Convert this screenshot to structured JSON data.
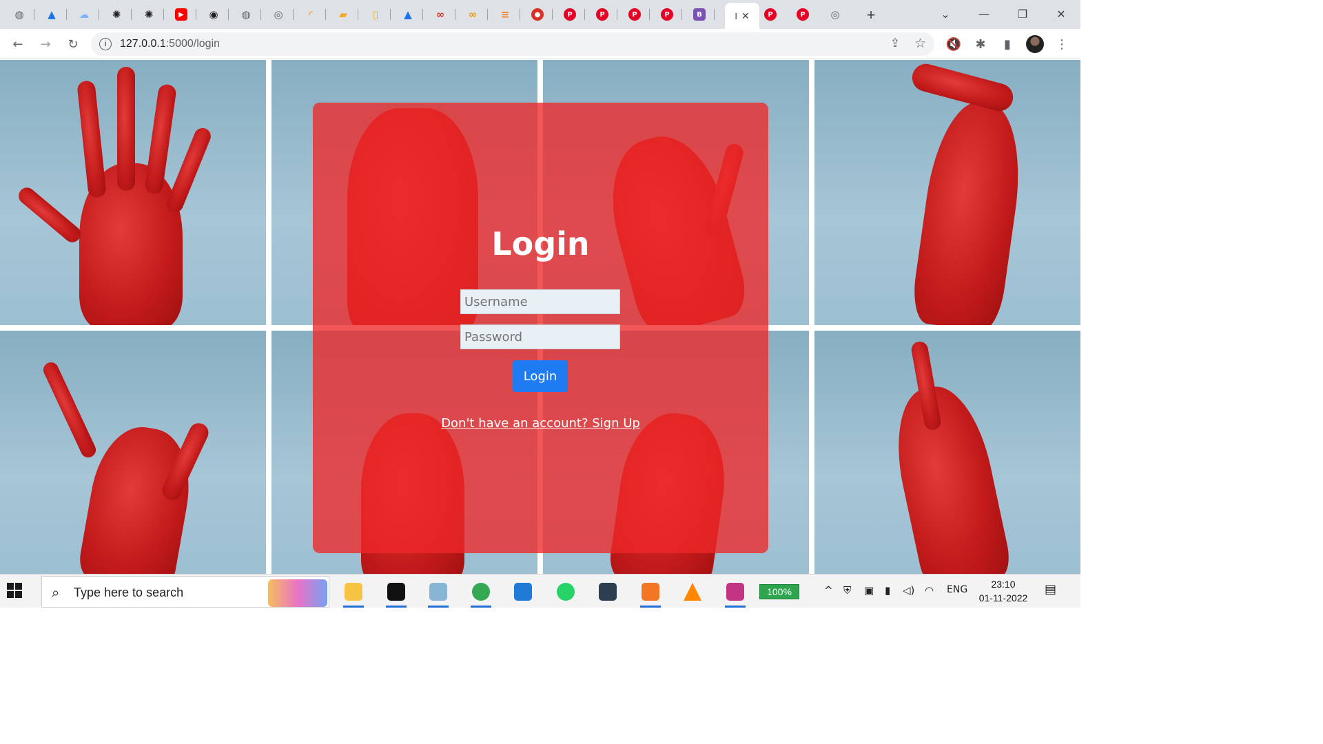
{
  "browser": {
    "tabs": [
      {
        "icon": "globe-icon",
        "color": "#5f6368"
      },
      {
        "icon": "google-drive-icon",
        "color": "#1a73e8"
      },
      {
        "icon": "cloud-icon",
        "color": "#7ab7ff"
      },
      {
        "icon": "watson-icon",
        "color": "#202124"
      },
      {
        "icon": "watson-icon",
        "color": "#202124"
      },
      {
        "icon": "youtube-icon",
        "color": "#ff0000"
      },
      {
        "icon": "github-icon",
        "color": "#202124"
      },
      {
        "icon": "globe-icon",
        "color": "#5f6368"
      },
      {
        "icon": "chrome-icon",
        "color": "#5f6368"
      },
      {
        "icon": "loading-icon",
        "color": "#f57c00"
      },
      {
        "icon": "book-icon",
        "color": "#f5a623"
      },
      {
        "icon": "document-icon",
        "color": "#f6b026"
      },
      {
        "icon": "google-drive-icon",
        "color": "#1a73e8"
      },
      {
        "icon": "infinity-icon",
        "color": "#d93025"
      },
      {
        "icon": "infinity-icon",
        "color": "#f29900"
      },
      {
        "icon": "stackoverflow-icon",
        "color": "#f48024"
      },
      {
        "icon": "record-icon",
        "color": "#d93025"
      },
      {
        "icon": "pinterest-icon",
        "color": "#e60023"
      },
      {
        "icon": "pinterest-icon",
        "color": "#e60023"
      },
      {
        "icon": "pinterest-icon",
        "color": "#e60023"
      },
      {
        "icon": "pinterest-icon",
        "color": "#e60023"
      },
      {
        "icon": "bootstrap-icon",
        "color": "#7952b3"
      }
    ],
    "active_tab": {
      "loading_glyph": "I",
      "close_glyph": "✕"
    },
    "tabs_after": [
      {
        "icon": "pinterest-icon",
        "color": "#e60023"
      },
      {
        "icon": "pinterest-icon",
        "color": "#e60023"
      },
      {
        "icon": "chrome-icon",
        "color": "#5f6368"
      }
    ],
    "new_tab_glyph": "+",
    "window_controls": {
      "search_tabs": "⌄",
      "minimize": "—",
      "restore": "❐",
      "close": "✕"
    },
    "toolbar": {
      "back": "←",
      "forward": "→",
      "reload": "↻",
      "info_glyph": "i",
      "url_host": "127.0.0.1",
      "url_rest": ":5000/login",
      "share": "⇪",
      "bookmark": "☆",
      "mute": "🔇",
      "extensions": "✱",
      "side_panel": "▮",
      "menu": "⋮"
    }
  },
  "login": {
    "title": "Login",
    "username_placeholder": "Username",
    "password_placeholder": "Password",
    "button_label": "Login",
    "signup_link": "Don't have an account? Sign Up",
    "card_color": "#ee2828",
    "button_color": "#1f7bf2"
  },
  "taskbar": {
    "search_placeholder": "Type here to search",
    "search_glyph": "⌕",
    "apps": [
      {
        "name": "file-explorer-icon",
        "color": "#f6c342",
        "underline": true
      },
      {
        "name": "terminal-icon",
        "color": "#111111",
        "underline": true
      },
      {
        "name": "notepad-icon",
        "color": "#88b4d6",
        "underline": true
      },
      {
        "name": "chrome-icon",
        "color": "#34a853",
        "underline": true
      },
      {
        "name": "vscode-icon",
        "color": "#1f7bd6",
        "underline": false
      },
      {
        "name": "whatsapp-icon",
        "color": "#25d366",
        "underline": false
      },
      {
        "name": "app-icon",
        "color": "#2d3e50",
        "underline": false
      },
      {
        "name": "jupyter-icon",
        "color": "#f37626",
        "underline": true
      },
      {
        "name": "vlc-icon",
        "color": "#ff8800",
        "underline": false
      },
      {
        "name": "instagram-icon",
        "color": "#c13584",
        "underline": true
      }
    ],
    "battery_label": "100%",
    "tray": {
      "chevron": "^",
      "language": "ENG"
    },
    "time": "23:10",
    "date": "01-11-2022",
    "notification_glyph": "▤"
  }
}
